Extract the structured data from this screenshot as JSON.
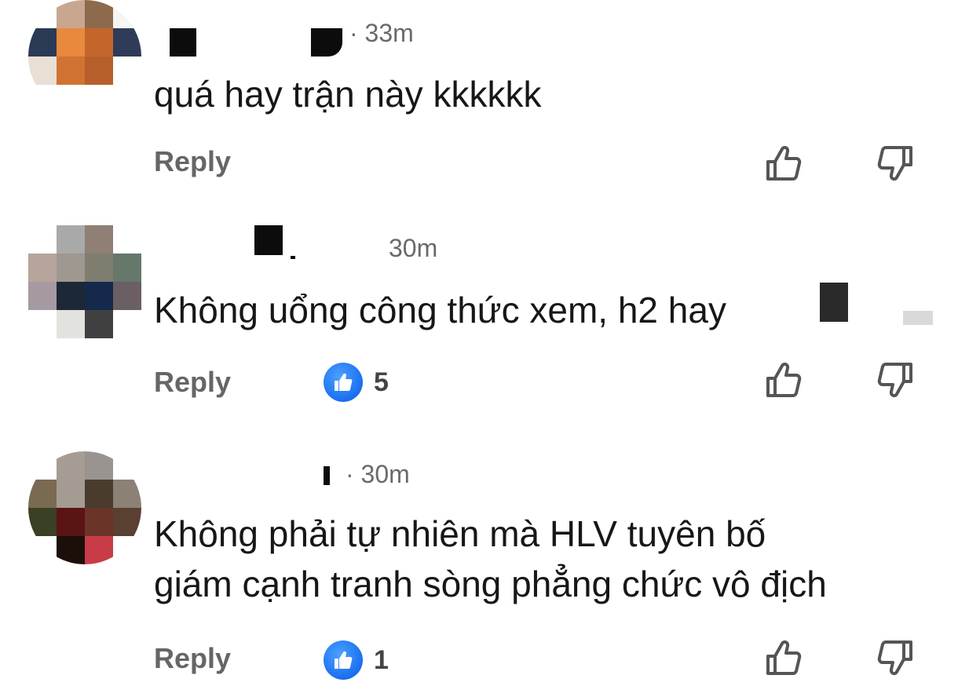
{
  "comments": [
    {
      "time": "· 33m",
      "text": "quá hay trận này kkkkkk",
      "reply_label": "Reply",
      "reaction_count": null,
      "avatar_colors": [
        "#ffffff",
        "#c9a690",
        "#8d6a4b",
        "#f5f5f5",
        "#2b3a55",
        "#e8893e",
        "#c4662c",
        "#2f3b58",
        "#e9dfd4",
        "#d07332",
        "#b65f2a",
        "#ffffff",
        "#ffffff",
        "#ffffff",
        "#ffffff",
        "#ffffff"
      ]
    },
    {
      "time": "30m",
      "text": "Không uổng công thức xem, h2 hay",
      "reply_label": "Reply",
      "reaction_count": "5",
      "avatar_colors": [
        "#ffffff",
        "#a9a9a9",
        "#8f7f75",
        "#ffffff",
        "#b7a49c",
        "#9e9890",
        "#7f7c70",
        "#65786a",
        "#a59aa1",
        "#1c2836",
        "#15294a",
        "#6b5f63",
        "#ffffff",
        "#e2e3df",
        "#404040",
        "#ffffff"
      ]
    },
    {
      "time": "· 30m",
      "text": "Không phải tự nhiên mà HLV tuyên bố\ngiám cạnh tranh sòng phẳng chức vô địch",
      "reply_label": "Reply",
      "reaction_count": "1",
      "avatar_colors": [
        "#ffffff",
        "#a59c93",
        "#9a9490",
        "#ffffff",
        "#7a6a52",
        "#a49c92",
        "#4a3c2c",
        "#8b8275",
        "#3a4024",
        "#5b1414",
        "#6a3428",
        "#5a4030",
        "#ffffff",
        "#1c0f0a",
        "#c83c48",
        "#ffffff"
      ]
    }
  ],
  "icons": {
    "upvote": "thumbs-up-outline",
    "downvote": "thumbs-down-outline",
    "reaction": "like-badge"
  },
  "colors": {
    "reply_text": "#666666",
    "meta_text": "#6a6a6a",
    "like_blue": "#1b6ff0"
  }
}
